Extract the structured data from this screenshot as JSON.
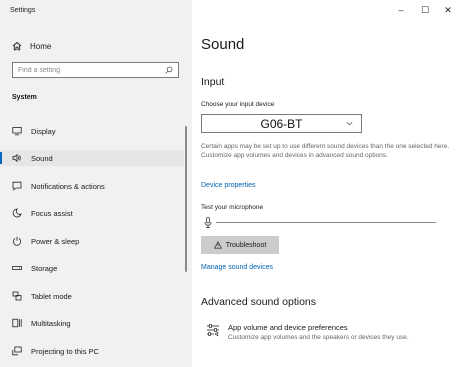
{
  "window": {
    "title": "Settings",
    "controls": {
      "minimize": "–",
      "maximize": "☐",
      "close": "✕"
    }
  },
  "sidebar": {
    "home_label": "Home",
    "search_placeholder": "Find a setting",
    "section_label": "System",
    "items": [
      {
        "label": "Display",
        "icon": "display-icon",
        "active": false
      },
      {
        "label": "Sound",
        "icon": "speaker-icon",
        "active": true
      },
      {
        "label": "Notifications & actions",
        "icon": "notifications-icon",
        "active": false
      },
      {
        "label": "Focus assist",
        "icon": "moon-icon",
        "active": false
      },
      {
        "label": "Power & sleep",
        "icon": "power-icon",
        "active": false
      },
      {
        "label": "Storage",
        "icon": "storage-icon",
        "active": false
      },
      {
        "label": "Tablet mode",
        "icon": "tablet-mode-icon",
        "active": false
      },
      {
        "label": "Multitasking",
        "icon": "multitasking-icon",
        "active": false
      },
      {
        "label": "Projecting to this PC",
        "icon": "projecting-icon",
        "active": false
      }
    ]
  },
  "main": {
    "page_title": "Sound",
    "input": {
      "heading": "Input",
      "choose_label": "Choose your input device",
      "selected_device": "G06-BT",
      "description": "Certain apps may be set up to use different sound devices than the one selected here. Customize app volumes and devices in advanced sound options.",
      "device_properties_link": "Device properties",
      "test_label": "Test your microphone",
      "mic_level": 0,
      "troubleshoot_label": "Troubleshoot",
      "manage_link": "Manage sound devices"
    },
    "advanced": {
      "heading": "Advanced sound options",
      "pref_title": "App volume and device preferences",
      "pref_subtitle": "Customize app volumes and the speakers or devices they use."
    }
  },
  "colors": {
    "sidebar_bg": "#f1f1f1",
    "accent": "#0067c0",
    "link": "#0063b1",
    "button_bg": "#cccccc"
  }
}
